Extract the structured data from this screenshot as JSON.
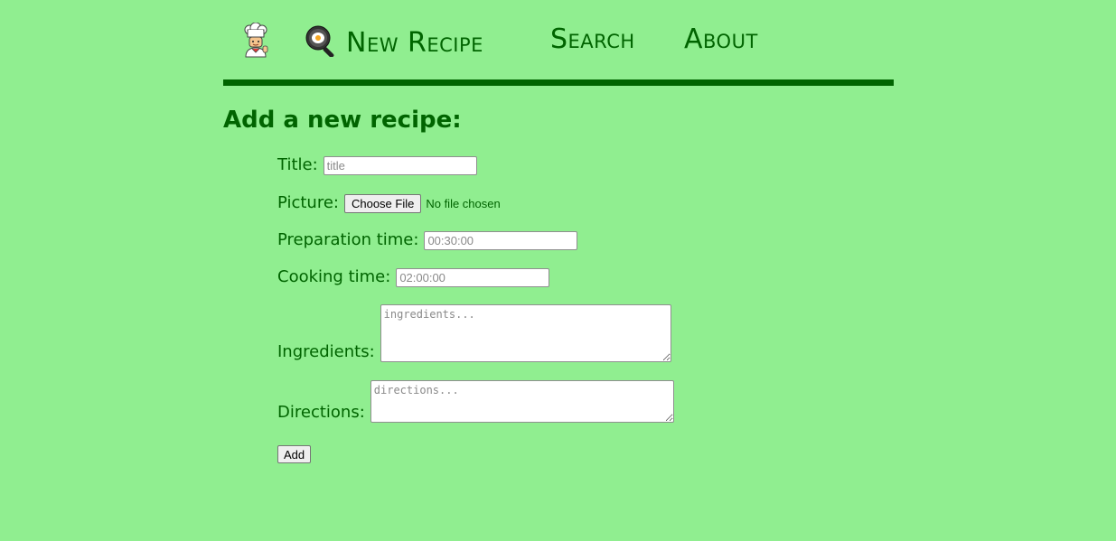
{
  "nav": {
    "logo_icon": "chef-icon",
    "links": [
      {
        "label": "New Recipe",
        "icon": "frying-pan-icon"
      },
      {
        "label": "Search"
      },
      {
        "label": "About"
      }
    ]
  },
  "page": {
    "heading": "Add a new recipe:"
  },
  "form": {
    "title": {
      "label": "Title:",
      "placeholder": "title",
      "value": ""
    },
    "picture": {
      "label": "Picture:",
      "button_label": "Choose File",
      "status": "No file chosen"
    },
    "preparation_time": {
      "label": "Preparation time:",
      "placeholder": "00:30:00",
      "value": ""
    },
    "cooking_time": {
      "label": "Cooking time:",
      "placeholder": "02:00:00",
      "value": ""
    },
    "ingredients": {
      "label": "Ingredients:",
      "placeholder": "ingredients..."
    },
    "directions": {
      "label": "Directions:",
      "placeholder": "directions..."
    },
    "submit_label": "Add"
  },
  "colors": {
    "background": "#90ee90",
    "accent": "#006400"
  }
}
